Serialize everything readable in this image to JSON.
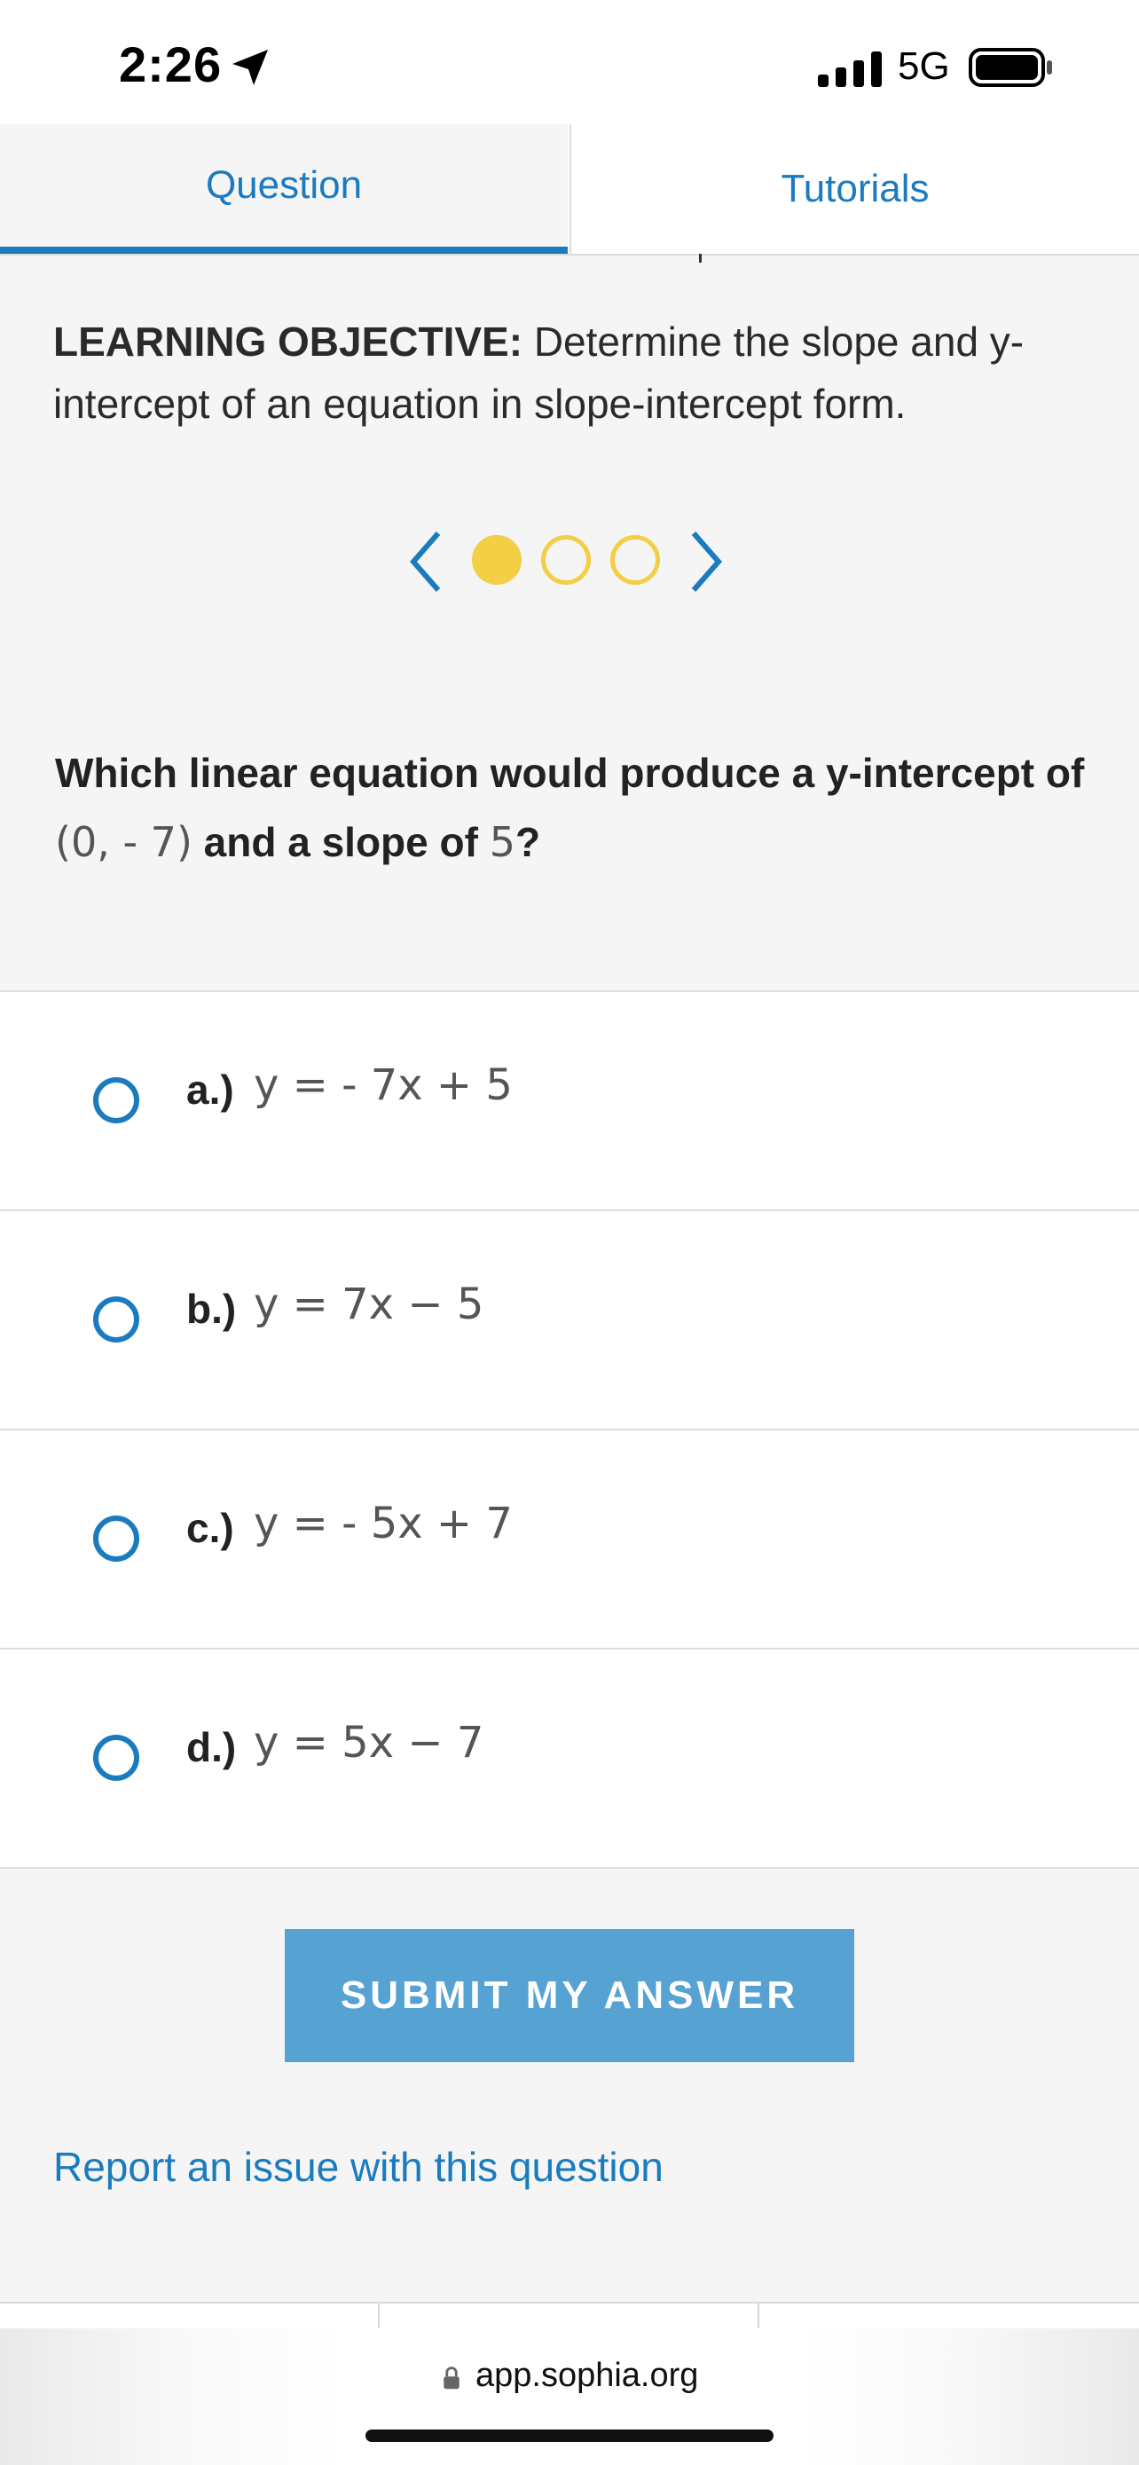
{
  "status": {
    "time": "2:26",
    "network": "5G"
  },
  "tabs": [
    {
      "label": "Question"
    },
    {
      "label": "Tutorials"
    }
  ],
  "objective": {
    "label": "LEARNING OBJECTIVE:",
    "text": " Determine the slope and y-intercept of an equation in slope-intercept form."
  },
  "carousel": {
    "current": 1,
    "total": 3
  },
  "question": {
    "part1": "Which linear equation would produce a y-intercept of ",
    "point": "(0, - 7)",
    "part2": " and a slope of ",
    "slope": "5",
    "part3": "?"
  },
  "options": [
    {
      "label": "a.)",
      "equation": "y = - 7x + 5"
    },
    {
      "label": "b.)",
      "equation": "y = 7x − 5"
    },
    {
      "label": "c.)",
      "equation": "y = - 5x + 7"
    },
    {
      "label": "d.)",
      "equation": "y = 5x − 7"
    }
  ],
  "submit_label": "SUBMIT MY ANSWER",
  "report_link": "Report an issue with this question",
  "browser": {
    "url": "app.sophia.org"
  },
  "colors": {
    "accent": "#1a7bbf",
    "dot": "#f2cf45",
    "submit_bg": "#55a2d3"
  }
}
